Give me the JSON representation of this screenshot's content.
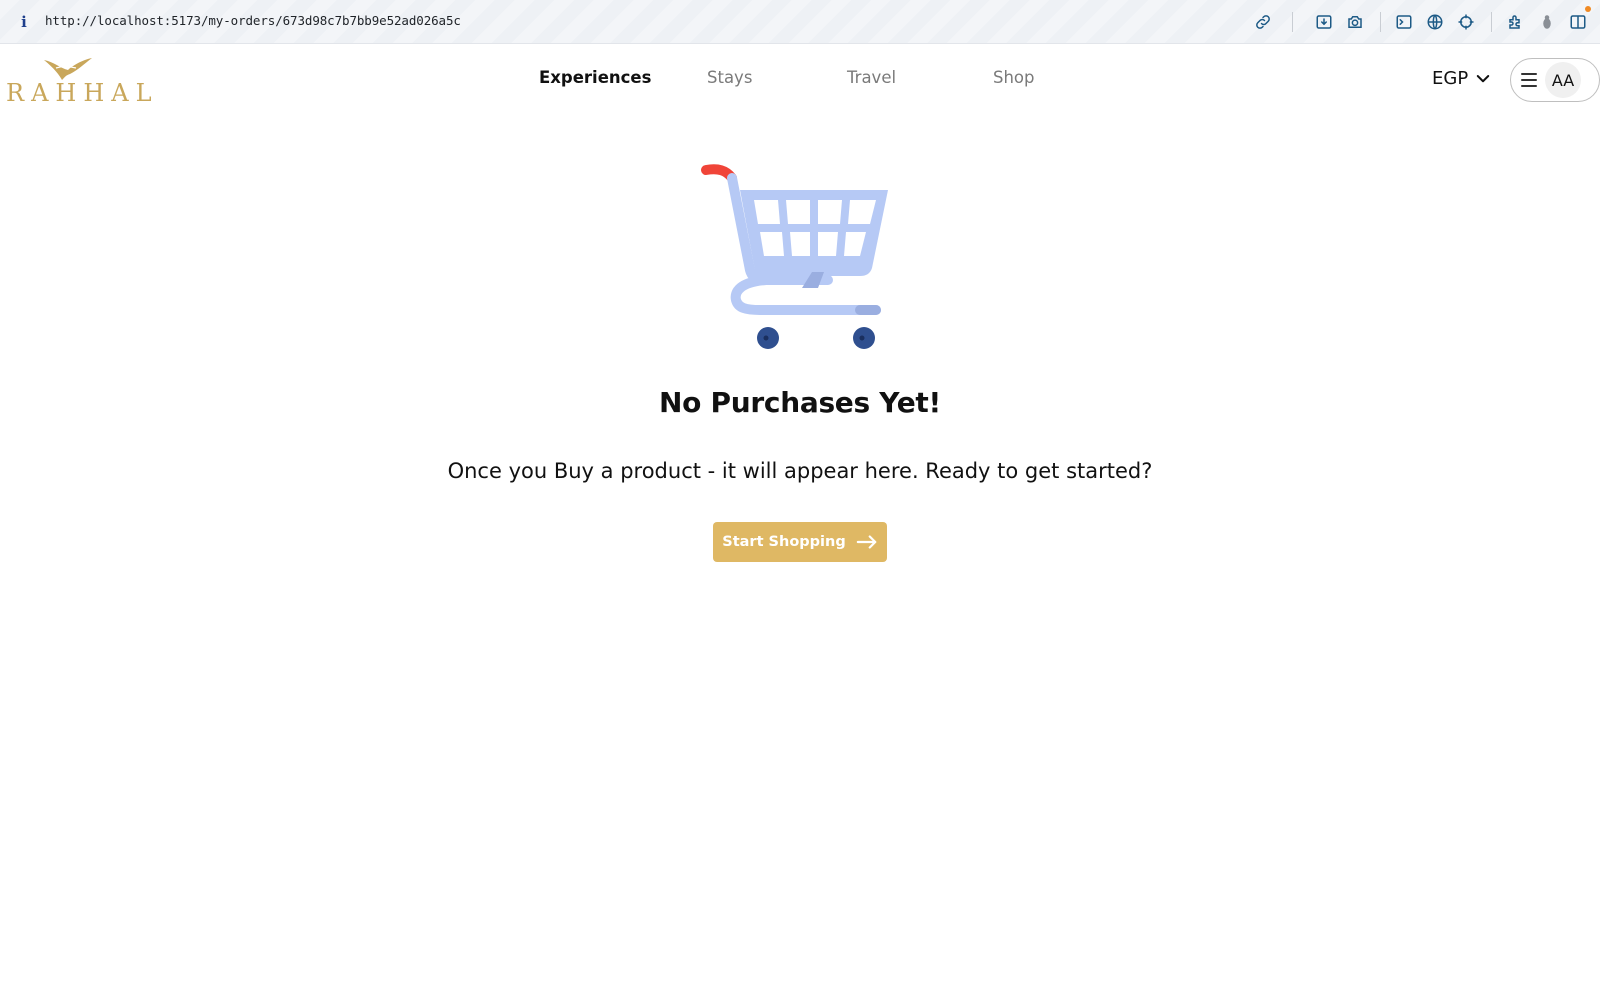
{
  "browser": {
    "info_icon": "i",
    "url": "http://localhost:5173/my-orders/673d98c7b7bb9e52ad026a5c",
    "toolbar_icons": [
      "link-icon",
      "download-icon",
      "camera-icon",
      "terminal-icon",
      "globe-icon",
      "crosshair-icon",
      "extensions-icon",
      "bug-icon",
      "sidebar-icon"
    ]
  },
  "header": {
    "logo_text": "RAHHAL",
    "nav": [
      {
        "label": "Experiences",
        "active": true
      },
      {
        "label": "Stays",
        "active": false
      },
      {
        "label": "Travel",
        "active": false
      },
      {
        "label": "Shop",
        "active": false
      }
    ],
    "currency": "EGP",
    "avatar_initials": "AA"
  },
  "empty_state": {
    "illustration": "shopping-cart-icon",
    "title": "No Purchases Yet!",
    "message": "Once you Buy a product - it will appear here. Ready to get started?",
    "button_label": "Start Shopping"
  },
  "colors": {
    "brand_gold": "#dfb864",
    "logo_gold": "#c9a75b",
    "cart_blue": "#b6c9f5",
    "cart_wheel": "#2f4f8f",
    "cart_handle": "#f04438"
  }
}
